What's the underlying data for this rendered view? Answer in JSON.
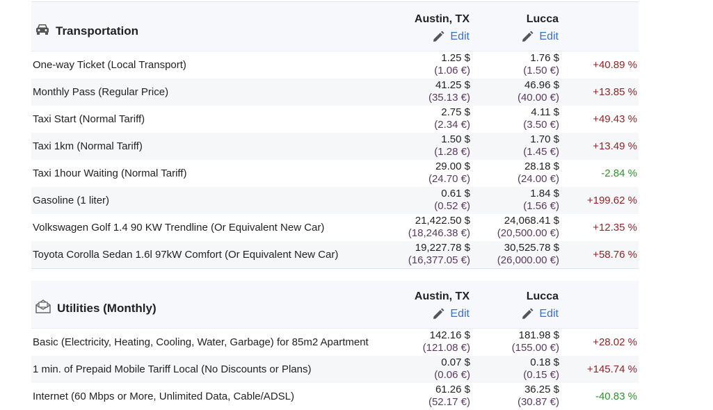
{
  "sections": [
    {
      "title": "Transportation",
      "icon": "car-icon",
      "city1": "Austin, TX",
      "city2": "Lucca",
      "edit_label": "Edit",
      "rows": [
        {
          "label": "One-way Ticket (Local Transport)",
          "c1_usd": "1.25 $",
          "c1_eur": "(1.06 €)",
          "c2_usd": "1.76 $",
          "c2_eur": "(1.50 €)",
          "diff": "+40.89 %",
          "sign": "pos"
        },
        {
          "label": "Monthly Pass (Regular Price)",
          "c1_usd": "41.25 $",
          "c1_eur": "(35.13 €)",
          "c2_usd": "46.96 $",
          "c2_eur": "(40.00 €)",
          "diff": "+13.85 %",
          "sign": "pos"
        },
        {
          "label": "Taxi Start (Normal Tariff)",
          "c1_usd": "2.75 $",
          "c1_eur": "(2.34 €)",
          "c2_usd": "4.11 $",
          "c2_eur": "(3.50 €)",
          "diff": "+49.43 %",
          "sign": "pos"
        },
        {
          "label": "Taxi 1km (Normal Tariff)",
          "c1_usd": "1.50 $",
          "c1_eur": "(1.28 €)",
          "c2_usd": "1.70 $",
          "c2_eur": "(1.45 €)",
          "diff": "+13.49 %",
          "sign": "pos"
        },
        {
          "label": "Taxi 1hour Waiting (Normal Tariff)",
          "c1_usd": "29.00 $",
          "c1_eur": "(24.70 €)",
          "c2_usd": "28.18 $",
          "c2_eur": "(24.00 €)",
          "diff": "-2.84 %",
          "sign": "neg"
        },
        {
          "label": "Gasoline (1 liter)",
          "c1_usd": "0.61 $",
          "c1_eur": "(0.52 €)",
          "c2_usd": "1.84 $",
          "c2_eur": "(1.56 €)",
          "diff": "+199.62 %",
          "sign": "pos"
        },
        {
          "label": "Volkswagen Golf 1.4 90 KW Trendline (Or Equivalent New Car)",
          "c1_usd": "21,422.50 $",
          "c1_eur": "(18,246.38 €)",
          "c2_usd": "24,068.41 $",
          "c2_eur": "(20,500.00 €)",
          "diff": "+12.35 %",
          "sign": "pos"
        },
        {
          "label": "Toyota Corolla Sedan 1.6l 97kW Comfort (Or Equivalent New Car)",
          "c1_usd": "19,227.78 $",
          "c1_eur": "(16,377.05 €)",
          "c2_usd": "30,525.78 $",
          "c2_eur": "(26,000.00 €)",
          "diff": "+58.76 %",
          "sign": "pos"
        }
      ]
    },
    {
      "title": "Utilities (Monthly)",
      "icon": "envelope-icon",
      "city1": "Austin, TX",
      "city2": "Lucca",
      "edit_label": "Edit",
      "rows": [
        {
          "label": "Basic (Electricity, Heating, Cooling, Water, Garbage) for 85m2 Apartment",
          "c1_usd": "142.16 $",
          "c1_eur": "(121.08 €)",
          "c2_usd": "181.98 $",
          "c2_eur": "(155.00 €)",
          "diff": "+28.02 %",
          "sign": "pos"
        },
        {
          "label": "1 min. of Prepaid Mobile Tariff Local (No Discounts or Plans)",
          "c1_usd": "0.07 $",
          "c1_eur": "(0.06 €)",
          "c2_usd": "0.18 $",
          "c2_eur": "(0.15 €)",
          "diff": "+145.74 %",
          "sign": "pos"
        },
        {
          "label": "Internet (60 Mbps or More, Unlimited Data, Cable/ADSL)",
          "c1_usd": "61.26 $",
          "c1_eur": "(52.17 €)",
          "c2_usd": "36.25 $",
          "c2_eur": "(30.87 €)",
          "diff": "-40.83 %",
          "sign": "neg"
        }
      ]
    }
  ],
  "colors": {
    "positive": "#8f2424",
    "negative": "#2f8f2f",
    "link": "#3a70c2",
    "header_bg": "#f6f8fc"
  }
}
